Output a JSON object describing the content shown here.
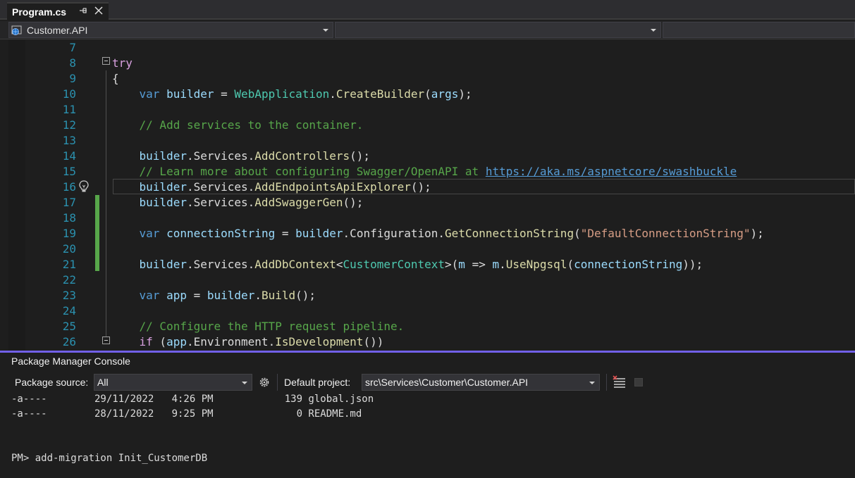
{
  "tab": {
    "title": "Program.cs"
  },
  "navbar": {
    "project": "Customer.API",
    "type": "",
    "member": ""
  },
  "editor": {
    "current_line": 16,
    "lines": [
      {
        "num": "7",
        "tokens": []
      },
      {
        "num": "8",
        "tokens": [
          {
            "t": "try",
            "c": "ctl"
          }
        ]
      },
      {
        "num": "9",
        "tokens": [
          {
            "t": "{",
            "c": ""
          }
        ]
      },
      {
        "num": "10",
        "tokens": [
          {
            "t": "    ",
            "c": ""
          },
          {
            "t": "var",
            "c": "kw"
          },
          {
            "t": " ",
            "c": ""
          },
          {
            "t": "builder",
            "c": "var"
          },
          {
            "t": " = ",
            "c": ""
          },
          {
            "t": "WebApplication",
            "c": "cls"
          },
          {
            "t": ".",
            "c": ""
          },
          {
            "t": "CreateBuilder",
            "c": "mth"
          },
          {
            "t": "(",
            "c": ""
          },
          {
            "t": "args",
            "c": "var"
          },
          {
            "t": ");",
            "c": ""
          }
        ]
      },
      {
        "num": "11",
        "tokens": []
      },
      {
        "num": "12",
        "tokens": [
          {
            "t": "    ",
            "c": ""
          },
          {
            "t": "// Add services to the container.",
            "c": "com"
          }
        ]
      },
      {
        "num": "13",
        "tokens": []
      },
      {
        "num": "14",
        "tokens": [
          {
            "t": "    ",
            "c": ""
          },
          {
            "t": "builder",
            "c": "var"
          },
          {
            "t": ".Services.",
            "c": ""
          },
          {
            "t": "AddControllers",
            "c": "mth"
          },
          {
            "t": "();",
            "c": ""
          }
        ]
      },
      {
        "num": "15",
        "tokens": [
          {
            "t": "    ",
            "c": ""
          },
          {
            "t": "// Learn more about configuring Swagger/OpenAPI at ",
            "c": "com"
          },
          {
            "t": "https://aka.ms/aspnetcore/swashbuckle",
            "c": "lnk"
          }
        ]
      },
      {
        "num": "16",
        "tokens": [
          {
            "t": "    ",
            "c": ""
          },
          {
            "t": "builder",
            "c": "var"
          },
          {
            "t": ".Services.",
            "c": ""
          },
          {
            "t": "AddEndpointsApiExplorer",
            "c": "mth"
          },
          {
            "t": "();",
            "c": ""
          }
        ]
      },
      {
        "num": "17",
        "tokens": [
          {
            "t": "    ",
            "c": ""
          },
          {
            "t": "builder",
            "c": "var"
          },
          {
            "t": ".Services.",
            "c": ""
          },
          {
            "t": "AddSwaggerGen",
            "c": "mth"
          },
          {
            "t": "();",
            "c": ""
          }
        ]
      },
      {
        "num": "18",
        "tokens": []
      },
      {
        "num": "19",
        "tokens": [
          {
            "t": "    ",
            "c": ""
          },
          {
            "t": "var",
            "c": "kw"
          },
          {
            "t": " ",
            "c": ""
          },
          {
            "t": "connectionString",
            "c": "var"
          },
          {
            "t": " = ",
            "c": ""
          },
          {
            "t": "builder",
            "c": "var"
          },
          {
            "t": ".Configuration.",
            "c": ""
          },
          {
            "t": "GetConnectionString",
            "c": "mth"
          },
          {
            "t": "(",
            "c": ""
          },
          {
            "t": "\"DefaultConnectionString\"",
            "c": "str"
          },
          {
            "t": ");",
            "c": ""
          }
        ]
      },
      {
        "num": "20",
        "tokens": []
      },
      {
        "num": "21",
        "tokens": [
          {
            "t": "    ",
            "c": ""
          },
          {
            "t": "builder",
            "c": "var"
          },
          {
            "t": ".Services.",
            "c": ""
          },
          {
            "t": "AddDbContext",
            "c": "mth"
          },
          {
            "t": "<",
            "c": ""
          },
          {
            "t": "CustomerContext",
            "c": "cls"
          },
          {
            "t": ">(",
            "c": ""
          },
          {
            "t": "m",
            "c": "var"
          },
          {
            "t": " => ",
            "c": ""
          },
          {
            "t": "m",
            "c": "var"
          },
          {
            "t": ".",
            "c": ""
          },
          {
            "t": "UseNpgsql",
            "c": "mth"
          },
          {
            "t": "(",
            "c": ""
          },
          {
            "t": "connectionString",
            "c": "var"
          },
          {
            "t": "));",
            "c": ""
          }
        ]
      },
      {
        "num": "22",
        "tokens": []
      },
      {
        "num": "23",
        "tokens": [
          {
            "t": "    ",
            "c": ""
          },
          {
            "t": "var",
            "c": "kw"
          },
          {
            "t": " ",
            "c": ""
          },
          {
            "t": "app",
            "c": "var"
          },
          {
            "t": " = ",
            "c": ""
          },
          {
            "t": "builder",
            "c": "var"
          },
          {
            "t": ".",
            "c": ""
          },
          {
            "t": "Build",
            "c": "mth"
          },
          {
            "t": "();",
            "c": ""
          }
        ]
      },
      {
        "num": "24",
        "tokens": []
      },
      {
        "num": "25",
        "tokens": [
          {
            "t": "    ",
            "c": ""
          },
          {
            "t": "// Configure the HTTP request pipeline.",
            "c": "com"
          }
        ]
      },
      {
        "num": "26",
        "tokens": [
          {
            "t": "    ",
            "c": ""
          },
          {
            "t": "if",
            "c": "ctl"
          },
          {
            "t": " (",
            "c": ""
          },
          {
            "t": "app",
            "c": "var"
          },
          {
            "t": ".Environment.",
            "c": ""
          },
          {
            "t": "IsDevelopment",
            "c": "mth"
          },
          {
            "t": "())",
            "c": ""
          }
        ]
      }
    ]
  },
  "console": {
    "title": "Package Manager Console",
    "source_label": "Package source:",
    "source_value": "All",
    "project_label": "Default project:",
    "project_value": "src\\Services\\Customer\\Customer.API",
    "output": [
      "-a----        29/11/2022   4:26 PM            139 global.json",
      "-a----        28/11/2022   9:25 PM              0 README.md",
      "",
      "",
      "PM> add-migration Init_CustomerDB"
    ]
  },
  "colors": {
    "accent": "#7160e8",
    "change_bar": "#57a64a",
    "line_number": "#2b91af"
  }
}
